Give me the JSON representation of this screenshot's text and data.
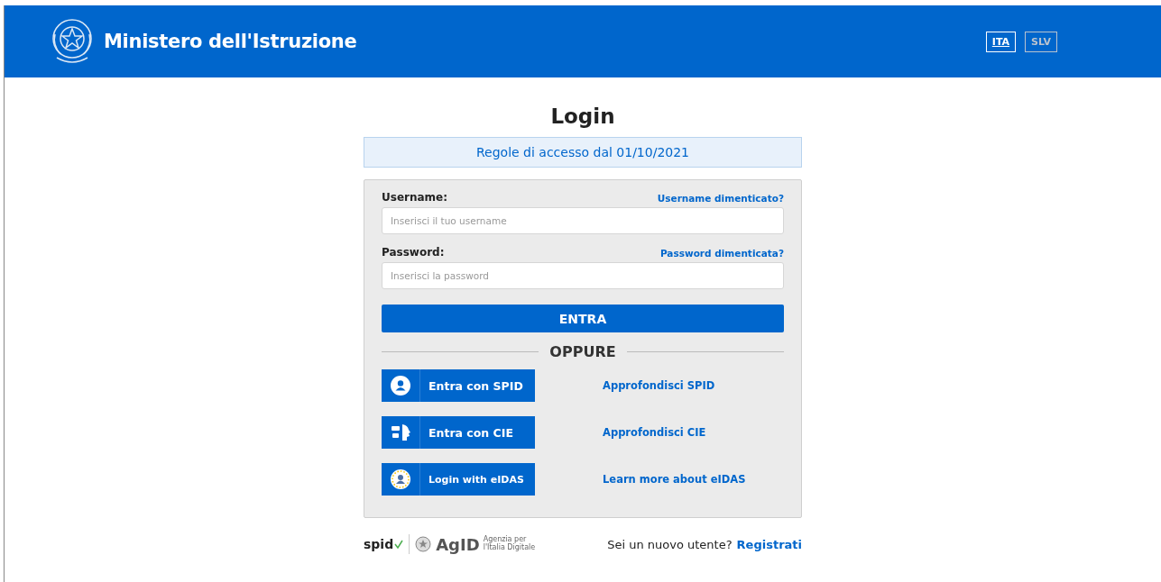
{
  "header": {
    "title": "Ministero dell'Istruzione",
    "languages": [
      {
        "label": "ITA",
        "selected": true
      },
      {
        "label": "SLV",
        "selected": false
      }
    ]
  },
  "title": "Login",
  "notice": "Regole di accesso dal 01/10/2021",
  "form": {
    "fields": [
      {
        "label": "Username:",
        "help_link": "Username dimenticato?",
        "placeholder": "Inserisci il tuo username"
      },
      {
        "label": "Password:",
        "help_link": "Password dimenticata?",
        "placeholder": "Inserisci la password"
      }
    ],
    "submit": "ENTRA",
    "separator": "OPPURE",
    "providers": [
      {
        "kind": "spid",
        "button": "Entra con SPID",
        "link": "Approfondisci SPID"
      },
      {
        "kind": "cie",
        "button": "Entra con CIE",
        "link": "Approfondisci CIE"
      },
      {
        "kind": "eidas",
        "button": "Login with eIDAS",
        "link": "Learn more about eIDAS"
      }
    ]
  },
  "footer": {
    "spid_logo": "spid",
    "agid_logo": "AgID",
    "agid_caption": "Agenzia per l'Italia Digitale",
    "question": "Sei un nuovo utente?",
    "register": "Registrati"
  }
}
